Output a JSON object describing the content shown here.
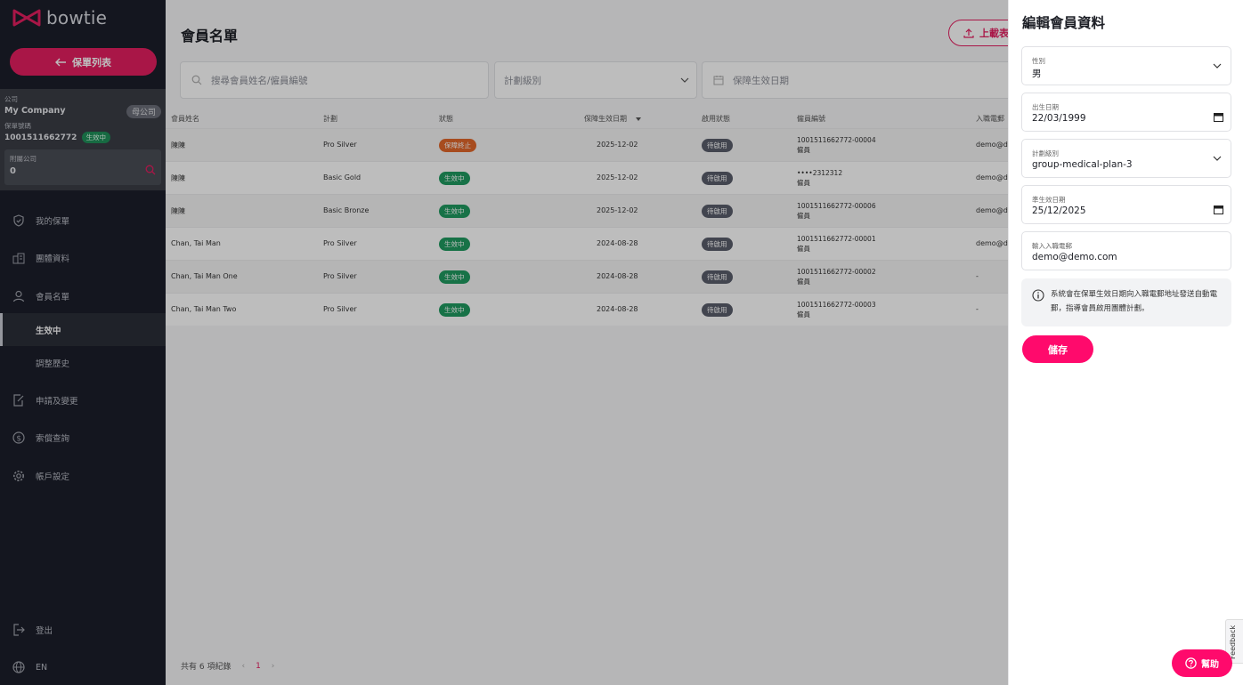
{
  "brand": {
    "name": "bowtie",
    "accent": "#e51e60",
    "sidebar_bg": "#1b1e2a"
  },
  "sidebar": {
    "back_label": "保單列表",
    "company_label": "公司",
    "company_name": "My Company",
    "parent_badge": "母公司",
    "policy_label": "保單號碼",
    "policy_no": "1001511662772",
    "policy_status": "生效中",
    "subsidiary_label": "附屬公司",
    "subsidiary_value": "0",
    "nav": [
      {
        "label": "我的保單",
        "icon": "shield-icon"
      },
      {
        "label": "團體資料",
        "icon": "building-icon"
      },
      {
        "label": "會員名單",
        "icon": "user-icon"
      },
      {
        "label": "申請及變更",
        "icon": "edit-doc-icon"
      },
      {
        "label": "索償查詢",
        "icon": "dollar-icon"
      },
      {
        "label": "帳戶設定",
        "icon": "gear-icon"
      }
    ],
    "sub_nav": [
      {
        "label": "生效中"
      },
      {
        "label": "調整歷史"
      }
    ],
    "logout_label": "登出",
    "lang_label": "EN"
  },
  "main": {
    "title": "會員名單",
    "upload_label": "上載表",
    "search_placeholder": "搜尋會員姓名/僱員編號",
    "plan_filter_placeholder": "計劃級別",
    "date_filter_placeholder": "保障生效日期",
    "columns": [
      "會員姓名",
      "計劃",
      "狀態",
      "保障生效日期",
      "啟用狀態",
      "僱員編號",
      "入職電郵"
    ],
    "rows": [
      {
        "name": "陳陳",
        "plan": "Pro Silver",
        "status": "保障終止",
        "status_color": "orange",
        "date": "2025-12-02",
        "activation": "待啟用",
        "emp_no": "1001511662772-00004",
        "emp_role": "僱員",
        "email": "demo@de"
      },
      {
        "name": "陳陳",
        "plan": "Basic Gold",
        "status": "生效中",
        "status_color": "green",
        "date": "2025-12-02",
        "activation": "待啟用",
        "emp_no": "••••2312312",
        "emp_role": "僱員",
        "email": "demo@de"
      },
      {
        "name": "陳陳",
        "plan": "Basic Bronze",
        "status": "生效中",
        "status_color": "green",
        "date": "2025-12-02",
        "activation": "待啟用",
        "emp_no": "1001511662772-00006",
        "emp_role": "僱員",
        "email": "demo@de"
      },
      {
        "name": "Chan, Tai Man",
        "plan": "Pro Silver",
        "status": "生效中",
        "status_color": "green",
        "date": "2024-08-28",
        "activation": "待啟用",
        "emp_no": "1001511662772-00001",
        "emp_role": "僱員",
        "email": "demo@de"
      },
      {
        "name": "Chan, Tai Man One",
        "plan": "Pro Silver",
        "status": "生效中",
        "status_color": "green",
        "date": "2024-08-28",
        "activation": "待啟用",
        "emp_no": "1001511662772-00002",
        "emp_role": "僱員",
        "email": "-"
      },
      {
        "name": "Chan, Tai Man Two",
        "plan": "Pro Silver",
        "status": "生效中",
        "status_color": "green",
        "date": "2024-08-28",
        "activation": "待啟用",
        "emp_no": "1001511662772-00003",
        "emp_role": "僱員",
        "email": "-"
      }
    ],
    "pager_total": "共有 6 項紀錄",
    "pager_current": "1"
  },
  "drawer": {
    "title": "編輯會員資料",
    "gender_label": "性別",
    "gender_value": "男",
    "dob_label": "出生日期",
    "dob_value": "22/03/1999",
    "plan_label": "計劃級別",
    "plan_value": "group-medical-plan-3",
    "effective_label": "準生效日期",
    "effective_value": "25/12/2025",
    "email_label": "輸入入職電郵",
    "email_value": "demo@demo.com",
    "info_text": "系統會在保單生效日期向入職電郵地址發送自動電郵，指導會員啟用團體計劃。",
    "save_label": "儲存"
  },
  "feedback_label": "Feedback",
  "help_label": "幫助"
}
